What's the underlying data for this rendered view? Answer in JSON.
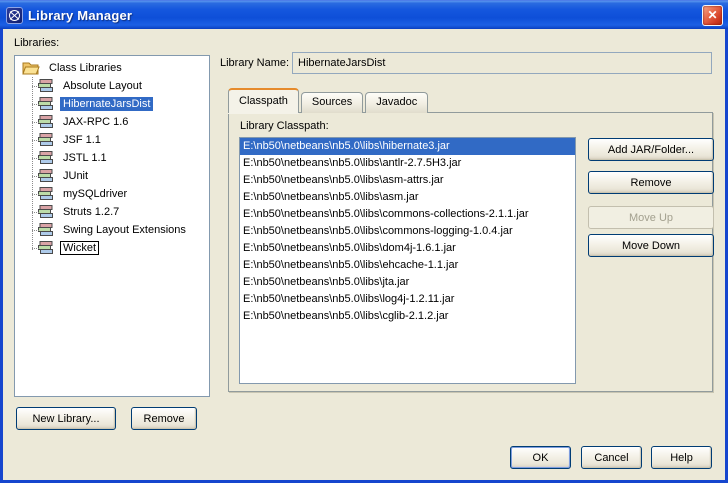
{
  "window": {
    "title": "Library Manager",
    "icon": "netbeans-logo-icon",
    "close": "close"
  },
  "colors": {
    "titlebar_blue": "#0E4FD8",
    "dialog_bg": "#ECE9D8",
    "selection_blue": "#316AC5",
    "tab_accent_orange": "#E68B2C",
    "close_red": "#D03A22"
  },
  "left": {
    "label": "Libraries:",
    "tree_root": "Class Libraries",
    "tree_items": [
      {
        "label": "Absolute Layout"
      },
      {
        "label": "HibernateJarsDist",
        "selected": true
      },
      {
        "label": "JAX-RPC 1.6"
      },
      {
        "label": "JSF 1.1"
      },
      {
        "label": "JSTL 1.1"
      },
      {
        "label": "JUnit"
      },
      {
        "label": "mySQLdriver"
      },
      {
        "label": "Struts 1.2.7"
      },
      {
        "label": "Swing Layout Extensions"
      },
      {
        "label": "Wicket",
        "focused": true
      }
    ],
    "new_library_button": "New Library...",
    "remove_button": "Remove"
  },
  "main": {
    "library_name_label": "Library Name:",
    "library_name_value": "HibernateJarsDist",
    "tabs": [
      {
        "label": "Classpath",
        "active": true
      },
      {
        "label": "Sources"
      },
      {
        "label": "Javadoc"
      }
    ],
    "classpath_label": "Library Classpath:",
    "classpath_items": [
      {
        "path": "E:\\nb50\\netbeans\\nb5.0\\libs\\hibernate3.jar",
        "selected": true
      },
      {
        "path": "E:\\nb50\\netbeans\\nb5.0\\libs\\antlr-2.7.5H3.jar"
      },
      {
        "path": "E:\\nb50\\netbeans\\nb5.0\\libs\\asm-attrs.jar"
      },
      {
        "path": "E:\\nb50\\netbeans\\nb5.0\\libs\\asm.jar"
      },
      {
        "path": "E:\\nb50\\netbeans\\nb5.0\\libs\\commons-collections-2.1.1.jar"
      },
      {
        "path": "E:\\nb50\\netbeans\\nb5.0\\libs\\commons-logging-1.0.4.jar"
      },
      {
        "path": "E:\\nb50\\netbeans\\nb5.0\\libs\\dom4j-1.6.1.jar"
      },
      {
        "path": "E:\\nb50\\netbeans\\nb5.0\\libs\\ehcache-1.1.jar"
      },
      {
        "path": "E:\\nb50\\netbeans\\nb5.0\\libs\\jta.jar"
      },
      {
        "path": "E:\\nb50\\netbeans\\nb5.0\\libs\\log4j-1.2.11.jar"
      },
      {
        "path": "E:\\nb50\\netbeans\\nb5.0\\libs\\cglib-2.1.2.jar"
      }
    ],
    "buttons": {
      "add_jar": "Add JAR/Folder...",
      "remove": "Remove",
      "move_up": "Move Up",
      "move_down": "Move Down"
    }
  },
  "footer": {
    "ok": "OK",
    "cancel": "Cancel",
    "help": "Help"
  }
}
